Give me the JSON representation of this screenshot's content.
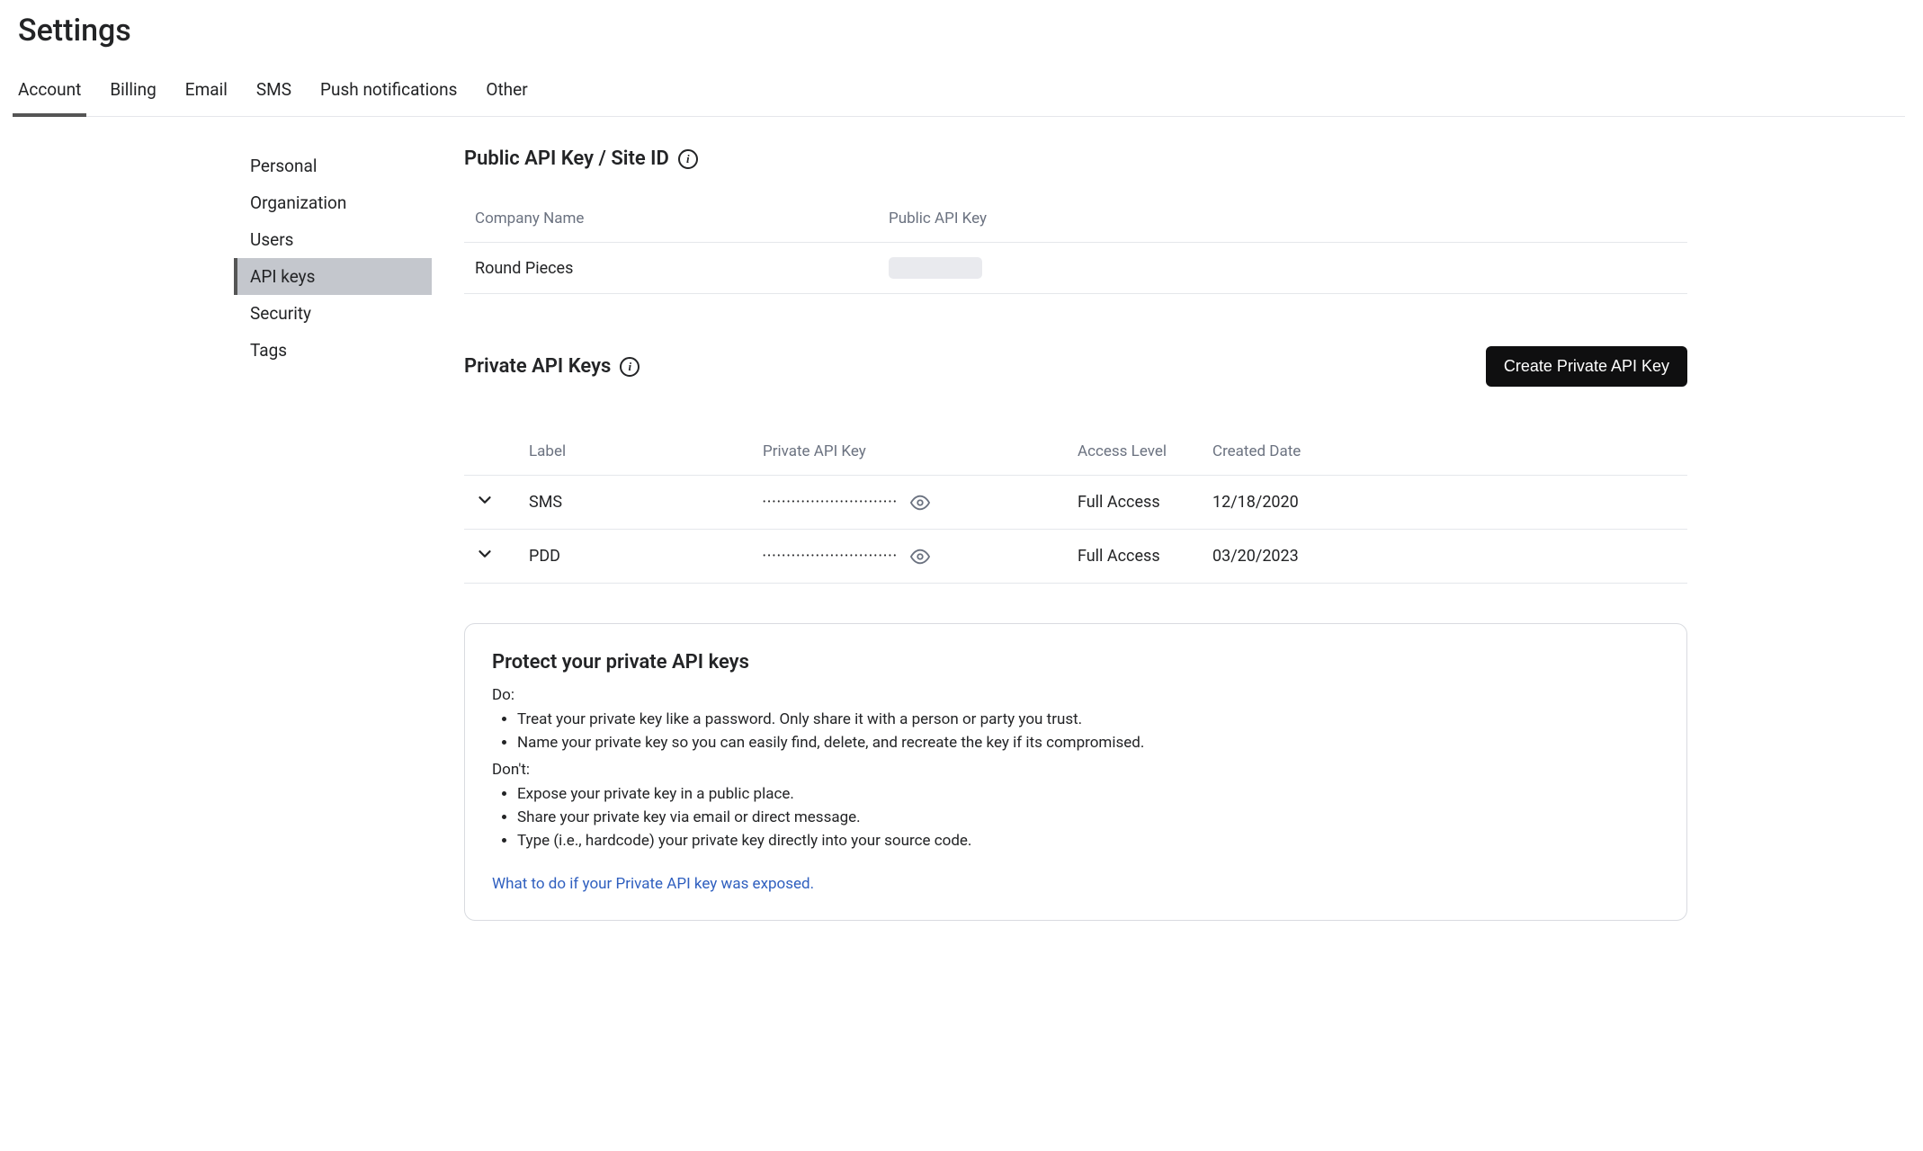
{
  "page_title": "Settings",
  "tabs": [
    "Account",
    "Billing",
    "Email",
    "SMS",
    "Push notifications",
    "Other"
  ],
  "active_tab": 0,
  "sidebar": {
    "items": [
      "Personal",
      "Organization",
      "Users",
      "API keys",
      "Security",
      "Tags"
    ],
    "active": 3
  },
  "public_section": {
    "title": "Public API Key / Site ID",
    "columns": [
      "Company Name",
      "Public API Key"
    ],
    "rows": [
      {
        "company": "Round Pieces",
        "key_masked": true
      }
    ]
  },
  "private_section": {
    "title": "Private API Keys",
    "create_button": "Create Private API Key",
    "columns": [
      "",
      "Label",
      "Private API Key",
      "Access Level",
      "Created Date"
    ],
    "rows": [
      {
        "label": "SMS",
        "key_dots": "••••••••••••••••••••••••••••",
        "access": "Full Access",
        "created": "12/18/2020"
      },
      {
        "label": "PDD",
        "key_dots": "••••••••••••••••••••••••••••",
        "access": "Full Access",
        "created": "03/20/2023"
      }
    ]
  },
  "protect": {
    "title": "Protect your private API keys",
    "do_label": "Do:",
    "do_items": [
      "Treat your private key like a password. Only share it with a person or party you trust.",
      "Name your private key so you can easily find, delete, and recreate the key if its compromised."
    ],
    "dont_label": "Don't:",
    "dont_items": [
      "Expose your private key in a public place.",
      "Share your private key via email or direct message.",
      "Type (i.e., hardcode) your private key directly into your source code."
    ],
    "link_text": "What to do if your Private API key was exposed."
  }
}
